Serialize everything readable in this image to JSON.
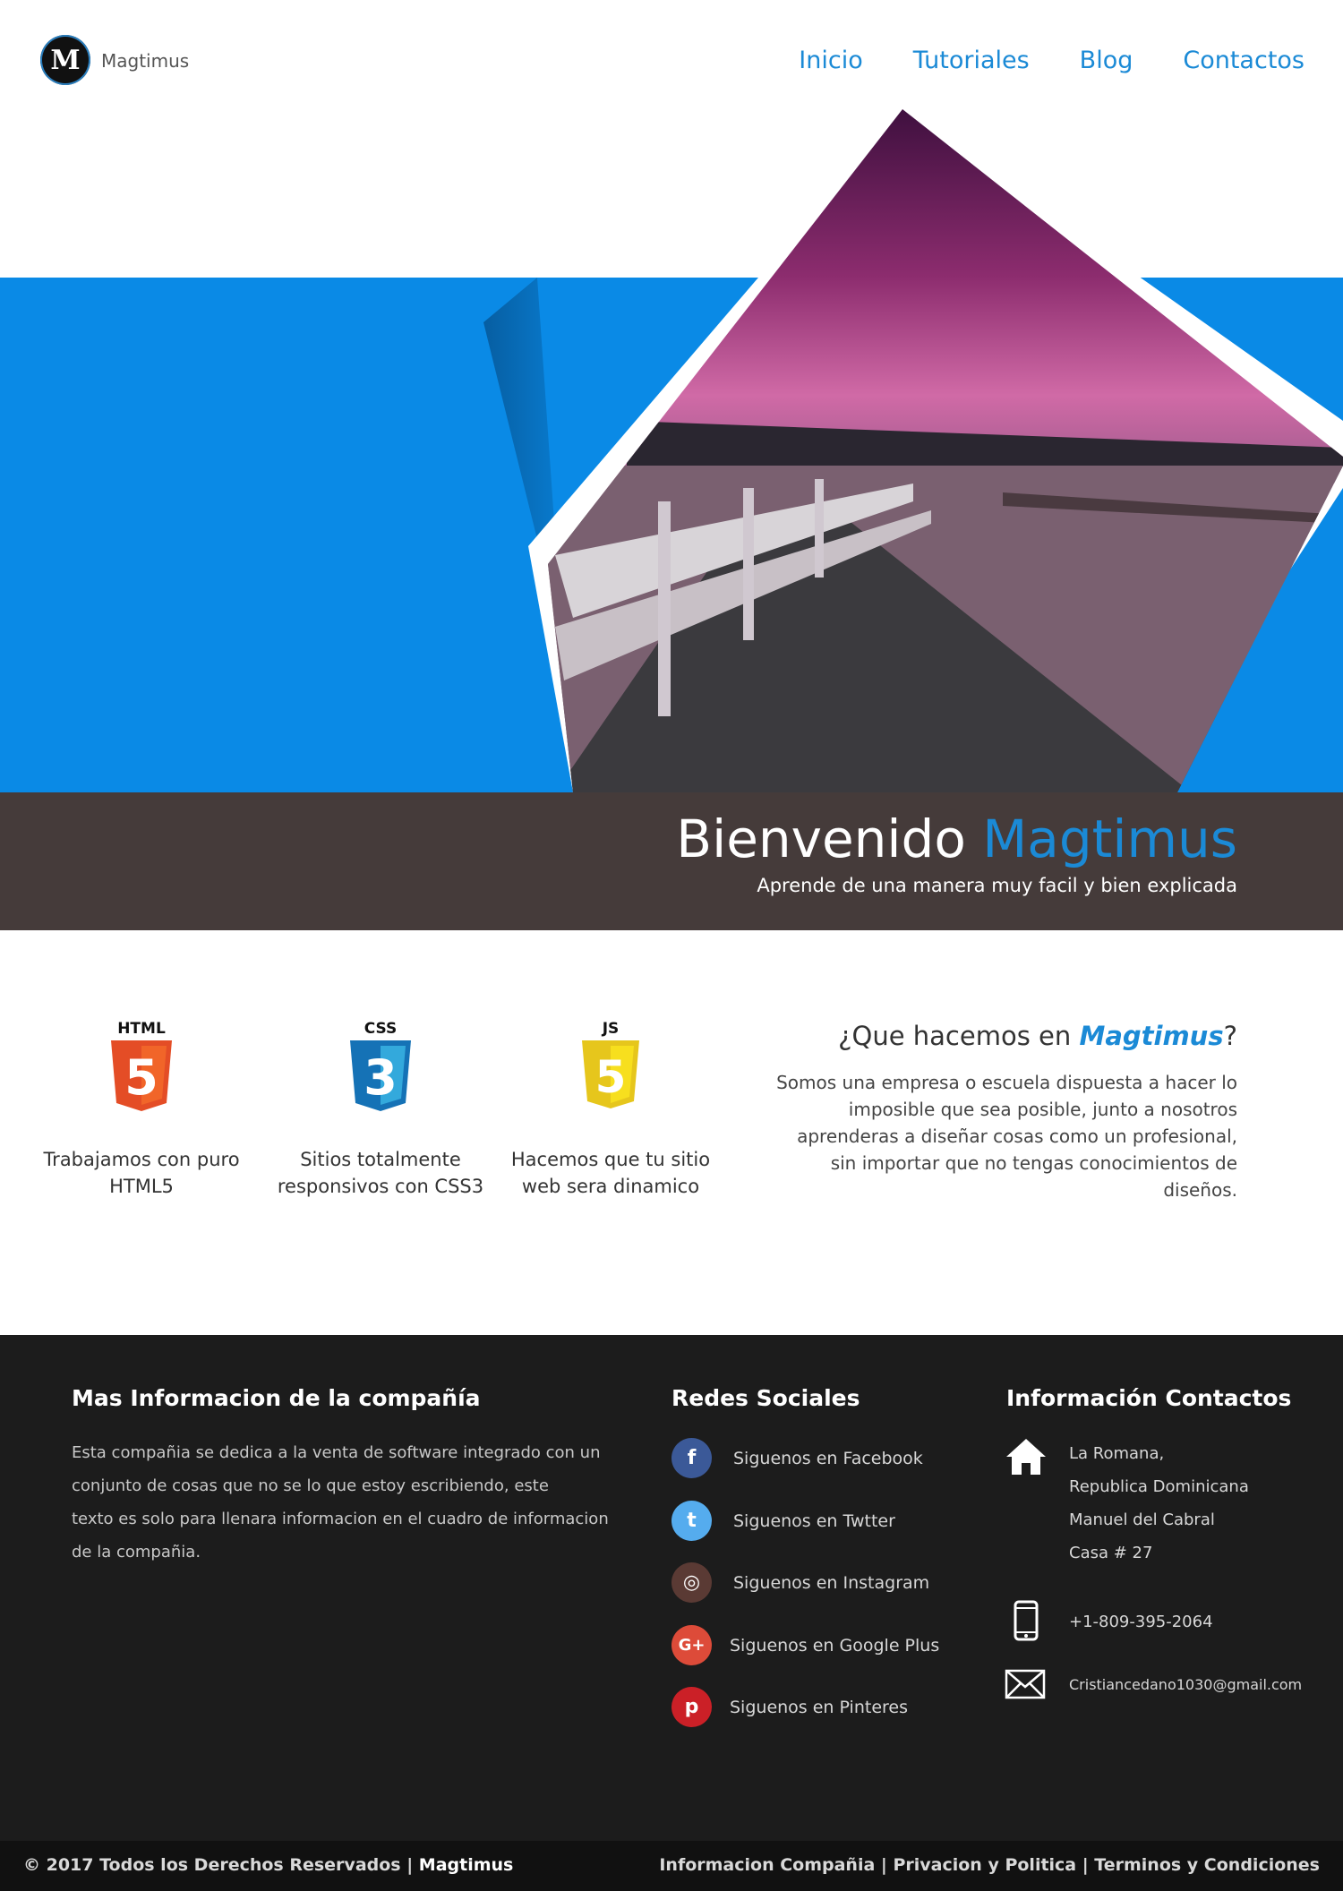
{
  "header": {
    "logo_letter": "M",
    "brand": "Magtimus",
    "nav": [
      "Inicio",
      "Tutoriales",
      "Blog",
      "Contactos"
    ]
  },
  "colors": {
    "accent": "#1b8ad6",
    "hero_blue": "#0a8ae6",
    "welcome_bg": "#453b3a",
    "footer_bg": "#1c1c1c",
    "bottom_bar_bg": "#111111"
  },
  "hero": {
    "image_description_icon": "pier-sunset-image",
    "welcome_prefix": "Bienvenido",
    "welcome_brand": "Magtimus",
    "subtitle": "Aprende de una manera muy facil y bien explicada"
  },
  "features": [
    {
      "icon": "html5-icon",
      "badge": "HTML",
      "number": "5",
      "text_line1": "Trabajamos con puro",
      "text_line2": "HTML5"
    },
    {
      "icon": "css3-icon",
      "badge": "CSS",
      "number": "3",
      "text_line1": "Sitios totalmente",
      "text_line2": "responsivos con CSS3"
    },
    {
      "icon": "js-icon",
      "badge": "JS",
      "number": "5",
      "text_line1": "Hacemos que tu sitio",
      "text_line2": "web sera dinamico"
    }
  ],
  "about": {
    "title_prefix": "¿Que hacemos en ",
    "title_brand": "Magtimus",
    "title_suffix": "?",
    "lines": [
      "Somos una empresa o escuela dispuesta a hacer lo",
      "imposible que sea posible, junto a nosotros",
      "aprenderas a diseñar cosas como un profesional,",
      "sin importar que no tengas conocimientos de",
      "diseños."
    ]
  },
  "footer": {
    "info_title": "Mas Informacion de la compañía",
    "info_lines": [
      "Esta compañia se dedica a la venta de software integrado con un",
      "conjunto de cosas que no se lo que estoy escribiendo, este",
      "texto es solo para llenara informacion en el cuadro de informacion",
      "de la compañia."
    ],
    "social_title": "Redes Sociales",
    "social": [
      {
        "icon": "facebook-icon",
        "glyph": "f",
        "color": "#3b5998",
        "label": "Siguenos en Facebook"
      },
      {
        "icon": "twitter-icon",
        "glyph": "t",
        "color": "#55acee",
        "label": "Siguenos en Twtter"
      },
      {
        "icon": "instagram-icon",
        "glyph": "◎",
        "color": "#5a3a34",
        "label": "Siguenos en Instagram"
      },
      {
        "icon": "google-plus-icon",
        "glyph": "G+",
        "color": "#dd4b39",
        "label": "Siguenos en Google Plus"
      },
      {
        "icon": "pinterest-icon",
        "glyph": "p",
        "color": "#cb2027",
        "label": "Siguenos en Pinteres"
      }
    ],
    "contact_title": "Información Contactos",
    "address_lines": [
      "La Romana,",
      "Republica Dominicana",
      "Manuel del Cabral",
      "Casa # 27"
    ],
    "phone": "+1-809-395-2064",
    "email": "Cristiancedano1030@gmail.com"
  },
  "bottom": {
    "copyright": "© 2017 Todos los Derechos Reservados | ",
    "brand": "Magtimus",
    "links": "Informacion Compañia | Privacion y Politica | Terminos y Condiciones"
  }
}
